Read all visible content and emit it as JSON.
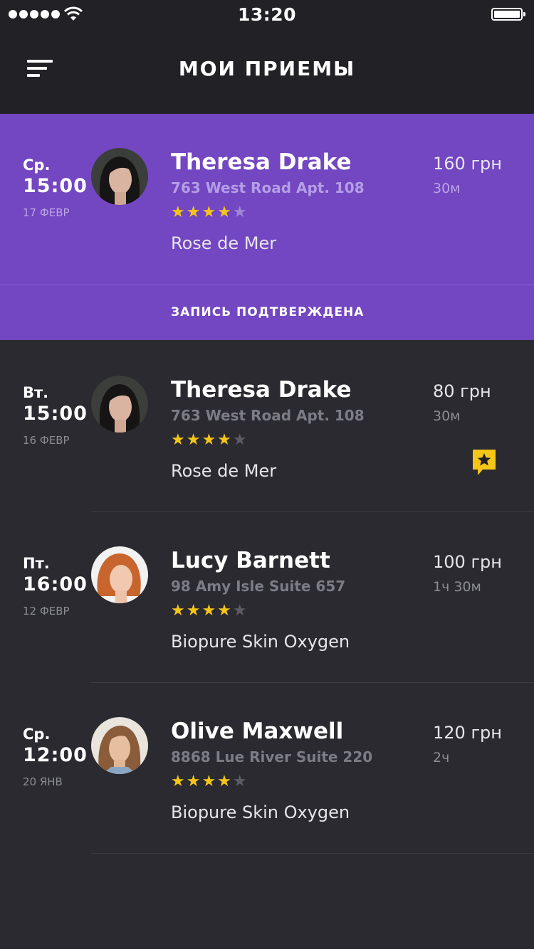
{
  "status_bar": {
    "time": "13:20"
  },
  "header": {
    "title": "МОИ ПРИЕМЫ"
  },
  "appointments": [
    {
      "day": "Ср.",
      "time": "15:00",
      "date": "17 ФЕВР",
      "name": "Theresa Drake",
      "address": "763 West Road Apt. 108",
      "rating": 4,
      "stars_on": "★★★★",
      "stars_off": "★",
      "service": "Rose de Mer",
      "price": "160 грн",
      "duration": "30м",
      "status": "ЗАПИСЬ ПОДТВЕРЖДЕНА"
    },
    {
      "day": "Вт.",
      "time": "15:00",
      "date": "16 ФЕВР",
      "name": "Theresa Drake",
      "address": "763 West Road Apt. 108",
      "rating": 4,
      "stars_on": "★★★★",
      "stars_off": "★",
      "service": "Rose de Mer",
      "price": "80 грн",
      "duration": "30м",
      "badge_icon": "review-star-icon"
    },
    {
      "day": "Пт.",
      "time": "16:00",
      "date": "12 ФЕВР",
      "name": "Lucy Barnett",
      "address": "98 Amy Isle Suite 657",
      "rating": 4,
      "stars_on": "★★★★",
      "stars_off": "★",
      "service": "Biopure Skin Oxygen",
      "price": "100 грн",
      "duration": "1ч 30м"
    },
    {
      "day": "Ср.",
      "time": "12:00",
      "date": "20 ЯНВ",
      "name": "Olive Maxwell",
      "address": "8868 Lue River Suite 220",
      "rating": 4,
      "stars_on": "★★★★",
      "stars_off": "★",
      "service": "Biopure Skin Oxygen",
      "price": "120 грн",
      "duration": "2ч"
    }
  ],
  "colors": {
    "accent": "#7346c2",
    "background": "#2a2a30",
    "header_background": "#222226",
    "star": "#f5c518",
    "badge": "#f5c518"
  }
}
